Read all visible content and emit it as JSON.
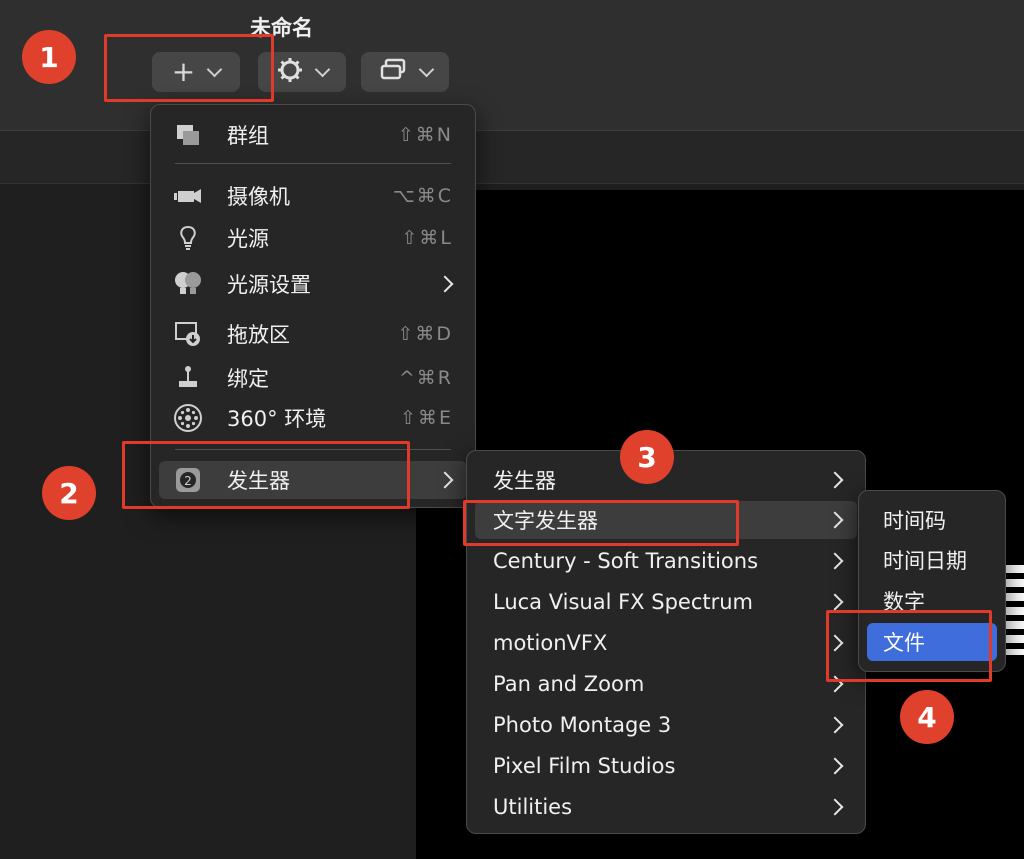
{
  "window": {
    "title": "未命名"
  },
  "menu": {
    "items": [
      {
        "label": "群组",
        "shortcut": "⇧⌘N"
      },
      {
        "label": "摄像机",
        "shortcut": "⌥⌘C"
      },
      {
        "label": "光源",
        "shortcut": "⇧⌘L"
      },
      {
        "label": "光源设置"
      },
      {
        "label": "拖放区",
        "shortcut": "⇧⌘D"
      },
      {
        "label": "绑定",
        "shortcut": "^⌘R"
      },
      {
        "label": "360° 环境",
        "shortcut": "⇧⌘E"
      },
      {
        "label": "发生器"
      }
    ]
  },
  "submenu": {
    "items": [
      {
        "label": "发生器"
      },
      {
        "label": "文字发生器"
      },
      {
        "label": "Century - Soft Transitions"
      },
      {
        "label": "Luca Visual FX Spectrum"
      },
      {
        "label": "motionVFX"
      },
      {
        "label": "Pan and Zoom"
      },
      {
        "label": "Photo Montage 3"
      },
      {
        "label": "Pixel Film Studios"
      },
      {
        "label": "Utilities"
      }
    ]
  },
  "submenu2": {
    "items": [
      {
        "label": "时间码"
      },
      {
        "label": "时间日期"
      },
      {
        "label": "数字"
      },
      {
        "label": "文件"
      }
    ]
  },
  "badges": [
    "1",
    "2",
    "3",
    "4"
  ],
  "colors": {
    "accent": "#3f6ddb",
    "annotation": "#e03a2a"
  }
}
